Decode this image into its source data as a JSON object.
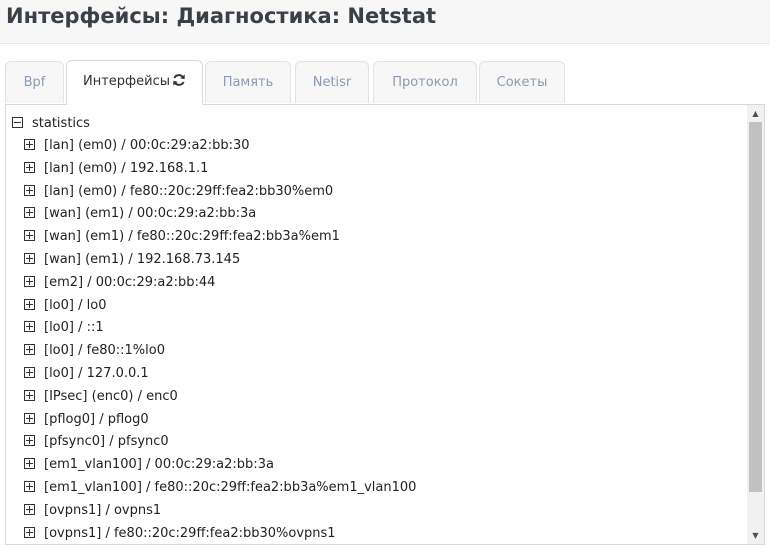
{
  "page": {
    "title": "Интерфейсы: Диагностика: Netstat"
  },
  "tabs": [
    {
      "label": "Bpf",
      "active": false
    },
    {
      "label": "Интерфейсы",
      "active": true
    },
    {
      "label": "Память",
      "active": false
    },
    {
      "label": "Netisr",
      "active": false
    },
    {
      "label": "Протокол",
      "active": false
    },
    {
      "label": "Сокеты",
      "active": false
    }
  ],
  "tree": {
    "root": {
      "label": "statistics",
      "expanded": true
    },
    "items": [
      {
        "label": "[lan] (em0) / 00:0c:29:a2:bb:30"
      },
      {
        "label": "[lan] (em0) / 192.168.1.1"
      },
      {
        "label": "[lan] (em0) / fe80::20c:29ff:fea2:bb30%em0"
      },
      {
        "label": "[wan] (em1) / 00:0c:29:a2:bb:3a"
      },
      {
        "label": "[wan] (em1) / fe80::20c:29ff:fea2:bb3a%em1"
      },
      {
        "label": "[wan] (em1) / 192.168.73.145"
      },
      {
        "label": "[em2] / 00:0c:29:a2:bb:44"
      },
      {
        "label": "[lo0] / lo0"
      },
      {
        "label": "[lo0] / ::1"
      },
      {
        "label": "[lo0] / fe80::1%lo0"
      },
      {
        "label": "[lo0] / 127.0.0.1"
      },
      {
        "label": "[IPsec] (enc0) / enc0"
      },
      {
        "label": "[pflog0] / pflog0"
      },
      {
        "label": "[pfsync0] / pfsync0"
      },
      {
        "label": "[em1_vlan100] / 00:0c:29:a2:bb:3a"
      },
      {
        "label": "[em1_vlan100] / fe80::20c:29ff:fea2:bb3a%em1_vlan100"
      },
      {
        "label": "[ovpns1] / ovpns1"
      },
      {
        "label": "[ovpns1] / fe80::20c:29ff:fea2:bb30%ovpns1"
      }
    ]
  },
  "colors": {
    "title": "#3a4048",
    "tab_inactive_text": "#8a9bb3",
    "tab_active_text": "#333333"
  },
  "icons": {
    "active_tab": "refresh-icon",
    "expanded": "minus-square-icon",
    "collapsed": "plus-square-icon"
  }
}
